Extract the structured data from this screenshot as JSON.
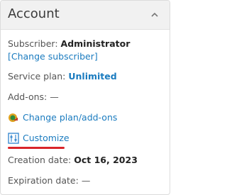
{
  "header": {
    "title": "Account"
  },
  "subscriber": {
    "label": "Subscriber:",
    "value": "Administrator",
    "change_link": "[Change subscriber]"
  },
  "service_plan": {
    "label": "Service plan:",
    "value": "Unlimited"
  },
  "addons": {
    "label": "Add-ons:",
    "value": "—"
  },
  "actions": {
    "change_plan": {
      "label": "Change plan/add-ons",
      "icon": "change-plan-icon"
    },
    "customize": {
      "label": "Customize",
      "icon": "customize-icon"
    }
  },
  "creation_date": {
    "label": "Creation date:",
    "value": "Oct 16, 2023"
  },
  "expiration_date": {
    "label": "Expiration date:",
    "value": "—"
  },
  "colors": {
    "link": "#1a7bbf",
    "accent_underline": "#d9252a",
    "header_bg": "#f1f1f1"
  }
}
